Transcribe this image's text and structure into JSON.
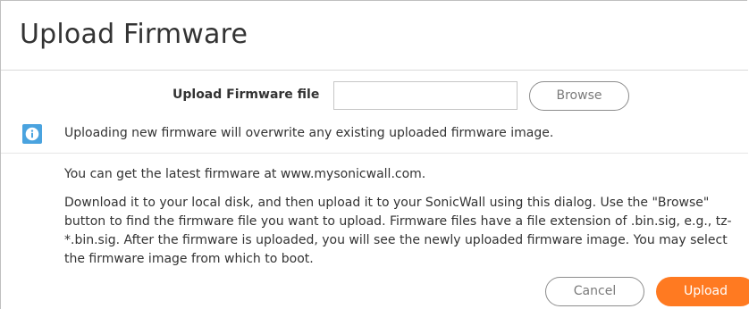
{
  "dialog": {
    "title": "Upload Firmware"
  },
  "form": {
    "file_label": "Upload Firmware file",
    "file_input_value": "",
    "browse_label": "Browse"
  },
  "info": {
    "icon": "info-icon",
    "icon_color": "#4aa3df",
    "message": "Uploading new firmware will overwrite any existing uploaded firmware image."
  },
  "content": {
    "paragraph1": "You can get the latest firmware at www.mysonicwall.com.",
    "paragraph2": "Download it to your local disk, and then upload it to your SonicWall using this dialog. Use the \"Browse\" button to find the firmware file you want to upload. Firmware files have a file extension of .bin.sig, e.g., tz-*.bin.sig. After the firmware is uploaded, you will see the newly uploaded firmware image. You may select the firmware image from which to boot."
  },
  "footer": {
    "cancel_label": "Cancel",
    "upload_label": "Upload",
    "upload_color": "#ff7a21"
  }
}
